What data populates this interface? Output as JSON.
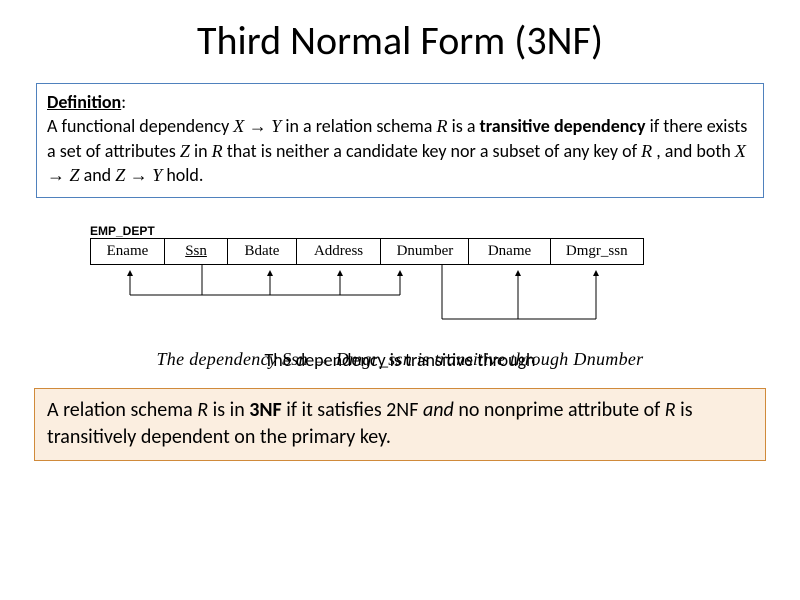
{
  "title": "Third Normal Form (3NF)",
  "definition": {
    "label": "Definition",
    "text_1": "A functional dependency ",
    "fd1": "X  →  Y",
    "text_2": " in a relation schema ",
    "R": "R",
    "text_3": " is a ",
    "trans": "transitive dependency",
    "text_4": " if there exists a set of attributes ",
    "Z": "Z",
    "text_5": " in ",
    "text_6": " that is neither a candidate key nor a subset of any key of ",
    "text_7": ", and both ",
    "fd2": "X  →  Z",
    "text_8": " and ",
    "fd3": "Z  →  Y",
    "text_9": " hold."
  },
  "figure": {
    "caption": "EMP_DEPT",
    "attrs": [
      "Ename",
      "Ssn",
      "Bdate",
      "Address",
      "Dnumber",
      "Dname",
      "Dmgr_ssn"
    ],
    "key_index": 1
  },
  "midline": {
    "back": "The dependency Ssn → Dmgr_ssn is transitive through Dnumber",
    "front": "The dependency  is transitive through "
  },
  "bottom": {
    "t1": "A relation schema ",
    "R": "R",
    "t2": " is in ",
    "tnf": "3NF",
    "t3": " if it satisfies 2NF ",
    "and": "and",
    "t4": " no nonprime attribute of ",
    "t5": " is transitively dependent on the primary key."
  }
}
